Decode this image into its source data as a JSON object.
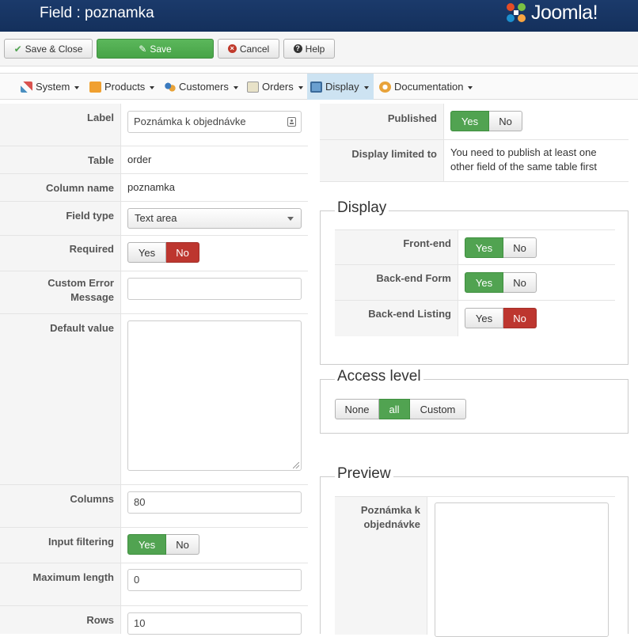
{
  "header": {
    "title": "Field : poznamka",
    "logo_text": "Joomla!"
  },
  "toolbar": {
    "save_close": "Save & Close",
    "save": "Save",
    "cancel": "Cancel",
    "help": "Help"
  },
  "menu": [
    {
      "label": "System",
      "icon": "tools-icon"
    },
    {
      "label": "Products",
      "icon": "box-icon"
    },
    {
      "label": "Customers",
      "icon": "users-icon"
    },
    {
      "label": "Orders",
      "icon": "clipboard-icon"
    },
    {
      "label": "Display",
      "icon": "monitor-icon",
      "active": true
    },
    {
      "label": "Documentation",
      "icon": "help-wheel-icon"
    }
  ],
  "form": {
    "label": {
      "label": "Label",
      "value": "Poznámka k objednávke"
    },
    "table": {
      "label": "Table",
      "value": "order"
    },
    "column_name": {
      "label": "Column name",
      "value": "poznamka"
    },
    "field_type": {
      "label": "Field type",
      "value": "Text area"
    },
    "required": {
      "label": "Required",
      "yes": "Yes",
      "no": "No",
      "selected": "No"
    },
    "custom_error": {
      "label_line1": "Custom Error",
      "label_line2": "Message",
      "value": ""
    },
    "default_value": {
      "label": "Default value",
      "value": ""
    },
    "columns": {
      "label": "Columns",
      "value": "80"
    },
    "input_filtering": {
      "label": "Input filtering",
      "yes": "Yes",
      "no": "No",
      "selected": "Yes"
    },
    "max_length": {
      "label": "Maximum length",
      "value": "0"
    },
    "rows": {
      "label": "Rows",
      "value": "10"
    }
  },
  "right": {
    "published": {
      "label": "Published",
      "yes": "Yes",
      "no": "No",
      "selected": "Yes"
    },
    "display_limited": {
      "label": "Display limited to",
      "text_line1": "You need to publish at least one",
      "text_line2": "other field of the same table first"
    },
    "display": {
      "legend": "Display",
      "frontend": {
        "label": "Front-end",
        "yes": "Yes",
        "no": "No",
        "selected": "Yes"
      },
      "backend_form": {
        "label": "Back-end Form",
        "yes": "Yes",
        "no": "No",
        "selected": "Yes"
      },
      "backend_listing": {
        "label": "Back-end Listing",
        "yes": "Yes",
        "no": "No",
        "selected": "No"
      }
    },
    "access": {
      "legend": "Access level",
      "none": "None",
      "all": "all",
      "custom": "Custom",
      "selected": "all"
    },
    "preview": {
      "legend": "Preview",
      "label_line1": "Poznámka k",
      "label_line2": "objednávke"
    }
  },
  "colors": {
    "header_bg": "#1b3a6b",
    "green": "#51a351",
    "red": "#bd362f",
    "active_menu": "#cde3f2"
  }
}
